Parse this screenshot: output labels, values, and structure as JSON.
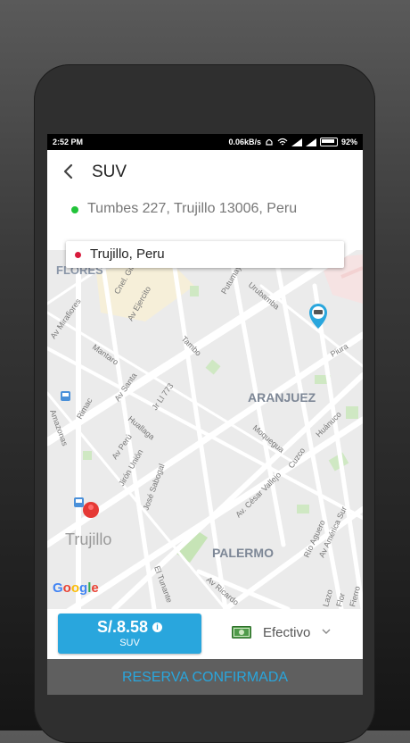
{
  "status_bar": {
    "time": "2:52 PM",
    "network_speed": "0.06kB/s",
    "battery": "92%"
  },
  "header": {
    "title": "SUV"
  },
  "trip": {
    "origin": "Tumbes 227, Trujillo 13006, Peru",
    "destination": "Trujillo, Peru"
  },
  "map": {
    "district_labels": [
      "FLORES",
      "ARANJUEZ",
      "PALERMO",
      "Trujillo"
    ],
    "street_labels": [
      "Cnel. Gil",
      "Av Ejercito",
      "Putumayo",
      "Urubamba",
      "Av Mirafiores",
      "Mantaro",
      "Tambo",
      "Av Santa",
      "Huallaga",
      "Av Perú",
      "Jr Ll 773",
      "Amazonas",
      "Rimac",
      "Jirón Unión",
      "José Sabogal",
      "Moquegua",
      "Cuzco",
      "Av. César Vallejo",
      "Huánuco",
      "Piura",
      "Av América Sur",
      "Río Aguero",
      "El Tunante",
      "Av Ricardo",
      "Lazo",
      "Flor",
      "Fierro"
    ],
    "logo": "Google"
  },
  "fare": {
    "amount": "S/.8.58",
    "vehicle": "SUV"
  },
  "payment": {
    "method": "Efectivo"
  },
  "footer": {
    "confirm_label": "RESERVA CONFIRMADA"
  },
  "colors": {
    "accent": "#29a6dd",
    "origin_dot": "#22c33a",
    "destination_dot": "#d81b3c",
    "confirm_bar": "#5f5f5f"
  }
}
